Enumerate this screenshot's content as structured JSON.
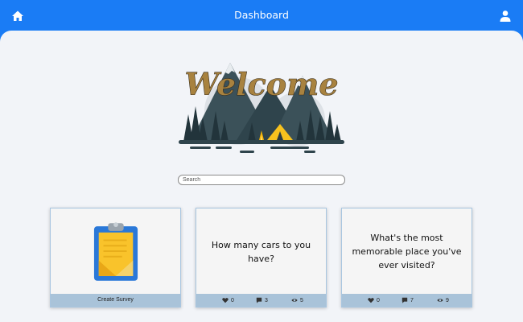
{
  "header": {
    "title": "Dashboard",
    "home_icon": "home-icon",
    "user_icon": "user-icon",
    "background": "#1a7cf5"
  },
  "hero": {
    "welcome_text": "Welcome",
    "illustration": "mountain-camp-illustration"
  },
  "search": {
    "placeholder": "Search",
    "value": ""
  },
  "cards": [
    {
      "type": "create",
      "label": "Create Survey",
      "icon": "clipboard-icon"
    },
    {
      "type": "survey",
      "question": "How many cars to you have?",
      "likes": "0",
      "comments": "3",
      "views": "5"
    },
    {
      "type": "survey",
      "question": "What's the most memorable place you've ever visited?",
      "likes": "0",
      "comments": "7",
      "views": "9"
    }
  ]
}
